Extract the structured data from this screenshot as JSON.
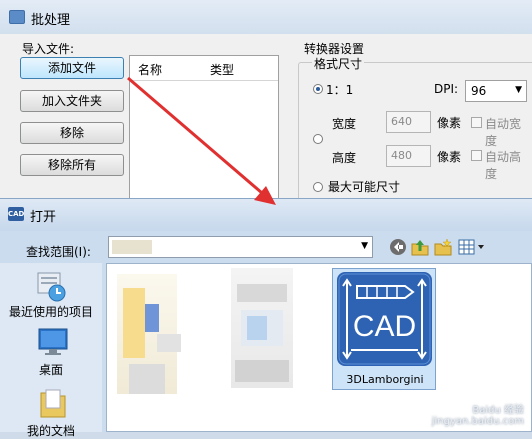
{
  "batch_window": {
    "title": "批处理",
    "import_group_label": "导入文件:",
    "buttons": {
      "add_file": "添加文件",
      "add_folder": "加入文件夹",
      "remove": "移除",
      "remove_all": "移除所有"
    },
    "file_list_columns": [
      "名称",
      "类型"
    ],
    "converter_settings_label": "转换器设置",
    "format_size_label": "格式尺寸",
    "ratio_option": "1：1",
    "dpi_label": "DPI:",
    "dpi_value": "96",
    "width_label": "宽度",
    "width_value": "640",
    "height_label": "高度",
    "height_value": "480",
    "pixel_label": "像素",
    "auto_width_label": "自动宽度",
    "auto_height_label": "自动高度",
    "max_size_option": "最大可能尺寸"
  },
  "open_dialog": {
    "title": "打开",
    "icon_label": "CAD",
    "look_in_label": "查找范围(I):",
    "places": {
      "recent": "最近使用的项目",
      "desktop": "桌面",
      "documents": "我的文档"
    },
    "selected_file": {
      "icon_text": "CAD",
      "name": "3DLamborgini"
    }
  },
  "watermark": {
    "line1": "Baidu 经验",
    "line2": "jingyan.baidu.com"
  },
  "colors": {
    "annotation_arrow": "#e03030",
    "cad_icon_blue": "#2e63b4",
    "selection_bg": "#cde3f7"
  }
}
